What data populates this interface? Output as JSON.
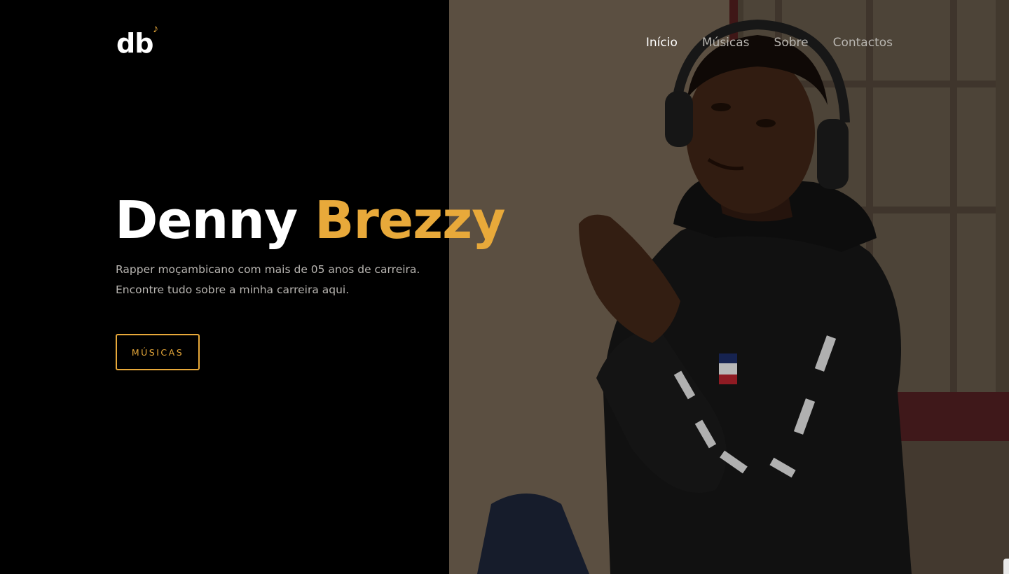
{
  "brand": {
    "logo_text": "db",
    "logo_icon": "music-note-icon",
    "accent_color": "#e8a93a"
  },
  "nav": {
    "items": [
      {
        "label": "Início",
        "active": true
      },
      {
        "label": "Músicas",
        "active": false
      },
      {
        "label": "Sobre",
        "active": false
      },
      {
        "label": "Contactos",
        "active": false
      }
    ]
  },
  "hero": {
    "title_first": "Denny",
    "title_last": "Brezzy",
    "subtitle_line1": "Rapper moçambicano com mais de 05 anos de carreira.",
    "subtitle_line2": "Encontre tudo sobre a minha carreira aqui.",
    "cta_label": "MÚSICAS"
  },
  "photo": {
    "icon": "artist-photo"
  }
}
